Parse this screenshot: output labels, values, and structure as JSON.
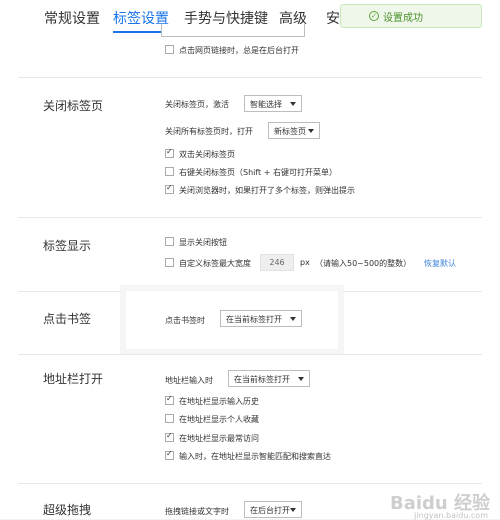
{
  "tabs": [
    {
      "label": "常规设置"
    },
    {
      "label": "标签设置"
    },
    {
      "label": "手势与快捷键"
    },
    {
      "label": "高级"
    },
    {
      "label": "安"
    }
  ],
  "toast": {
    "text": "设置成功",
    "icon": "checkmark-circle-icon",
    "color": "#4a8f2a"
  },
  "top_partial": {
    "option": "点击网页链接时，总是在后台打开"
  },
  "close_tab": {
    "title": "关闭标签页",
    "activate_label": "关闭标签页，激活",
    "activate_value": "智能选择",
    "close_all_label": "关闭所有标签页时，打开",
    "close_all_value": "新标签页",
    "options": [
      {
        "label": "双击关闭标签页",
        "checked": true
      },
      {
        "label": "右键关闭标签页（Shift + 右键可打开菜单）",
        "checked": false
      },
      {
        "label": "关闭浏览器时，如果打开了多个标签，则弹出提示",
        "checked": true
      }
    ]
  },
  "tab_display": {
    "title": "标签显示",
    "show_close_label": "显示关闭按钮",
    "show_close_checked": false,
    "custom_width_label": "自定义标签最大宽度",
    "custom_width_checked": false,
    "width_value": "246",
    "width_unit": "px",
    "width_hint": "（请输入50~500的整数）",
    "restore_label": "恢复默认"
  },
  "bookmark_click": {
    "title": "点击书签",
    "label": "点击书签时",
    "value": "在当前标签打开"
  },
  "address_bar": {
    "title": "地址栏打开",
    "label": "地址栏输入时",
    "value": "在当前标签打开",
    "options": [
      {
        "label": "在地址栏显示输入历史",
        "checked": true
      },
      {
        "label": "在地址栏显示个人收藏",
        "checked": false
      },
      {
        "label": "在地址栏显示最常访问",
        "checked": true
      },
      {
        "label": "输入时，在地址栏显示智能匹配和搜索直达",
        "checked": true
      }
    ]
  },
  "super_drag": {
    "title": "超级拖拽",
    "label": "拖拽链接或文字时",
    "value": "在后台打开"
  },
  "accent_color": "#1a73e8",
  "watermark": {
    "text": "Baidu 经验",
    "sub": "jingyan.baidu.com"
  }
}
